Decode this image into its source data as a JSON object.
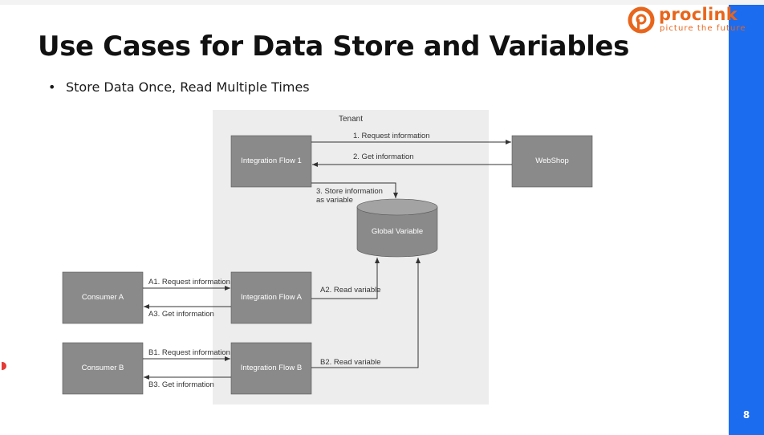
{
  "logo": {
    "name": "proclink",
    "tagline": "picture the future",
    "brand_color": "#e8651c"
  },
  "slide": {
    "title": "Use Cases for Data Store and Variables",
    "page_number": "8",
    "accent_color": "#1c6cf0"
  },
  "bullets": [
    "Store Data Once, Read Multiple Times"
  ],
  "diagram": {
    "tenant_label": "Tenant",
    "nodes": {
      "integration_flow_1": "Integration Flow 1",
      "webshop": "WebShop",
      "global_variable": "Global Variable",
      "consumer_a": "Consumer A",
      "integration_flow_a": "Integration Flow A",
      "consumer_b": "Consumer B",
      "integration_flow_b": "Integration Flow B"
    },
    "edges": {
      "request_information": "1. Request information",
      "get_information": "2. Get information",
      "store_information_line1": "3. Store information",
      "store_information_line2": "as variable",
      "a1_request": "A1. Request information",
      "a2_read": "A2. Read variable",
      "a3_get": "A3. Get information",
      "b1_request": "B1. Request information",
      "b2_read": "B2. Read variable",
      "b3_get": "B3. Get information"
    }
  }
}
